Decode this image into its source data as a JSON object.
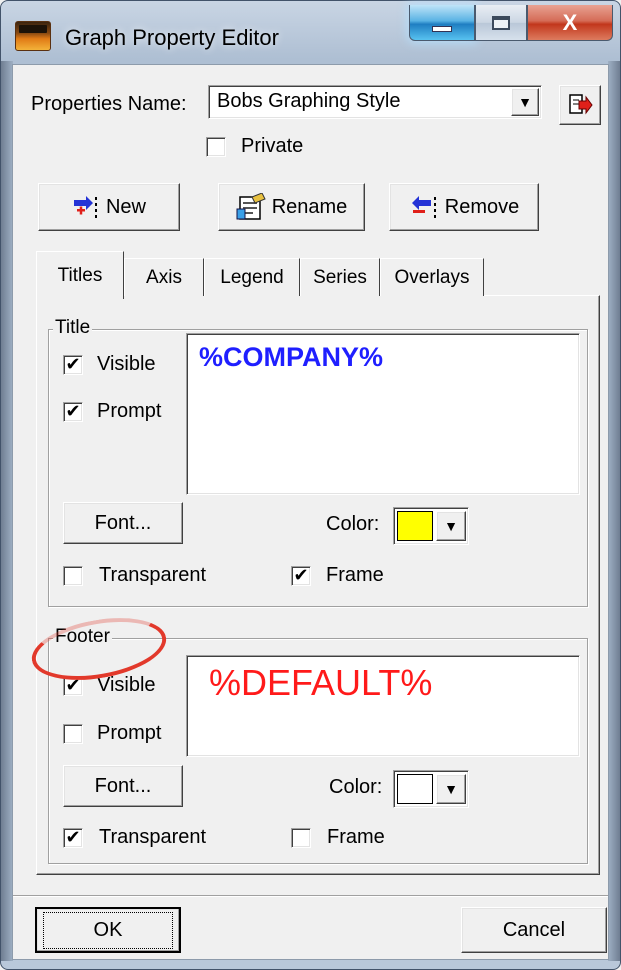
{
  "window": {
    "title": "Graph Property Editor",
    "close_glyph": "X"
  },
  "properties": {
    "name_label": "Properties Name:",
    "name_value": "Bobs Graphing Style",
    "private_label": "Private",
    "private_checked": false
  },
  "toolbar": {
    "new_label": "New",
    "rename_label": "Rename",
    "remove_label": "Remove"
  },
  "tabs": [
    {
      "label": "Titles",
      "active": true
    },
    {
      "label": "Axis",
      "active": false
    },
    {
      "label": "Legend",
      "active": false
    },
    {
      "label": "Series",
      "active": false
    },
    {
      "label": "Overlays",
      "active": false
    }
  ],
  "title_group": {
    "label": "Title",
    "visible_label": "Visible",
    "visible_checked": true,
    "prompt_label": "Prompt",
    "prompt_checked": true,
    "text_value": "%COMPANY%",
    "text_color": "#1f1fff",
    "font_button": "Font...",
    "color_label": "Color:",
    "color_value": "#ffff00",
    "transparent_label": "Transparent",
    "transparent_checked": false,
    "frame_label": "Frame",
    "frame_checked": true
  },
  "footer_group": {
    "label": "Footer",
    "visible_label": "Visible",
    "visible_checked": true,
    "prompt_label": "Prompt",
    "prompt_checked": false,
    "text_value": "%DEFAULT%",
    "text_color": "#ff1a1a",
    "font_button": "Font...",
    "color_label": "Color:",
    "color_value": "#ffffff",
    "transparent_label": "Transparent",
    "transparent_checked": true,
    "frame_label": "Frame",
    "frame_checked": false
  },
  "footer_buttons": {
    "ok_label": "OK",
    "cancel_label": "Cancel"
  },
  "glyphs": {
    "check": "✔",
    "dropdown": "▼"
  },
  "icons": {
    "app": "app-icon",
    "export": "export-icon",
    "new": "new-icon",
    "rename": "rename-icon",
    "remove": "remove-icon"
  }
}
